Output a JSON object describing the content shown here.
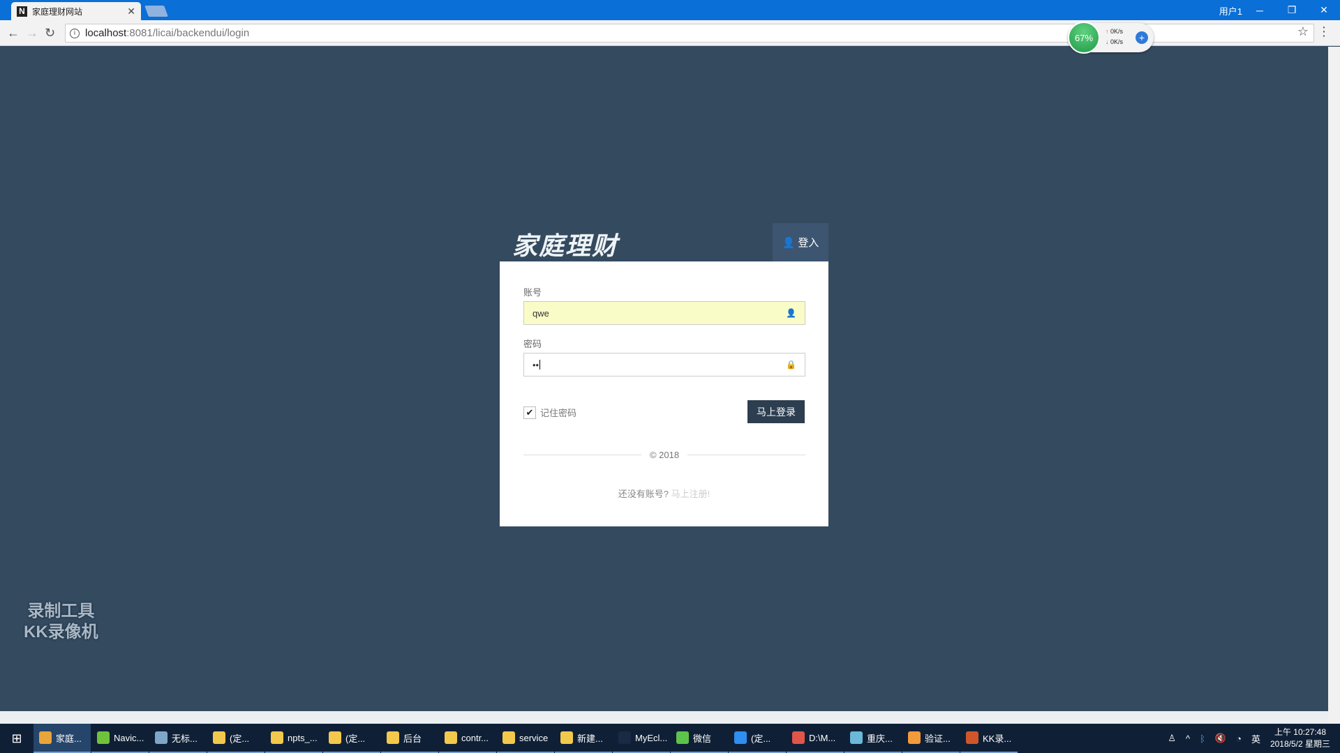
{
  "browser": {
    "tab_title": "家庭理财网站",
    "tab_favicon": "N",
    "url_host": "localhost",
    "url_rest": ":8081/licai/backendui/login",
    "window_user": "用户1"
  },
  "netmon": {
    "percent": "67%",
    "up": "0K/s",
    "down": "0K/s"
  },
  "login": {
    "logo": "家庭理财",
    "tab_label": "登入",
    "account_label": "账号",
    "account_value": "qwe",
    "password_label": "密码",
    "password_value": "••",
    "remember_label": "记住密码",
    "remember_checked": true,
    "submit_label": "马上登录",
    "copyright": "© 2018",
    "no_account": "还没有账号?",
    "register_link": "马上注册!"
  },
  "watermark": {
    "line1": "录制工具",
    "line2": "KK录像机"
  },
  "taskbar": {
    "items": [
      {
        "label": "家庭...",
        "color": "#e8a53a"
      },
      {
        "label": "Navic...",
        "color": "#6fc23a"
      },
      {
        "label": "无标...",
        "color": "#7ea6c8"
      },
      {
        "label": "(定...",
        "color": "#f2c94c"
      },
      {
        "label": "npts_...",
        "color": "#f2c94c"
      },
      {
        "label": "(定...",
        "color": "#f2c94c"
      },
      {
        "label": "后台",
        "color": "#f2c94c"
      },
      {
        "label": "contr...",
        "color": "#f2c94c"
      },
      {
        "label": "service",
        "color": "#f2c94c"
      },
      {
        "label": "新建...",
        "color": "#f2c94c"
      },
      {
        "label": "MyEcl...",
        "color": "#1b2a44"
      },
      {
        "label": "微信",
        "color": "#5ec34a"
      },
      {
        "label": "(定...",
        "color": "#2f8ef0"
      },
      {
        "label": "D:\\M...",
        "color": "#e0554a"
      },
      {
        "label": "重庆...",
        "color": "#6bb8d8"
      },
      {
        "label": "验证...",
        "color": "#f39a3a"
      },
      {
        "label": "KK录...",
        "color": "#d0562a"
      }
    ],
    "ime": "英",
    "time": "上午 10:27:48",
    "date": "2018/5/2 星期三"
  }
}
